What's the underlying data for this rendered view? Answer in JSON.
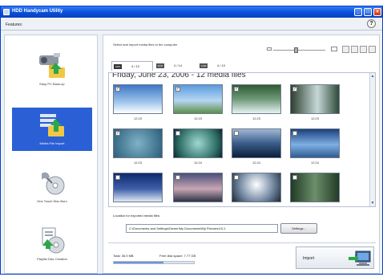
{
  "window": {
    "title": "HDD Handycam Utility",
    "help_label": "?"
  },
  "features_label": "Features:",
  "sidebar": {
    "items": [
      {
        "label": "Easy PC Back-up",
        "icon": "camera-to-folder-icon",
        "active": false
      },
      {
        "label": "Media File Import",
        "icon": "media-import-icon",
        "active": true
      },
      {
        "label": "One Touch Disc Burn",
        "icon": "disc-burn-icon",
        "active": false
      },
      {
        "label": "Playlist Disc Creation",
        "icon": "playlist-disc-icon",
        "active": false
      }
    ]
  },
  "main": {
    "instruction": "Select and import media files to the computer",
    "tabs": [
      {
        "badge": "HDD",
        "count": "4 / 10"
      },
      {
        "badge": "DVD",
        "count": "4 / 14"
      },
      {
        "badge": "CAM",
        "count": "4 / 10"
      }
    ],
    "date_heading": "Friday, June 23, 2006 - 12 media files",
    "thumbs": [
      {
        "time": "12:23",
        "checked": true
      },
      {
        "time": "12:23",
        "checked": true
      },
      {
        "time": "12:23",
        "checked": true
      },
      {
        "time": "12:23",
        "checked": true
      },
      {
        "time": "12:23",
        "checked": true
      },
      {
        "time": "12:24",
        "checked": false
      },
      {
        "time": "12:24",
        "checked": false
      },
      {
        "time": "12:24",
        "checked": false
      },
      {
        "time": "",
        "checked": false
      },
      {
        "time": "",
        "checked": false
      },
      {
        "time": "",
        "checked": false
      },
      {
        "time": "",
        "checked": false
      }
    ],
    "location_label": "Location for exported media files:",
    "location_path": "C:\\Documents and Settings\\Owner\\My Documents\\My Pictures\\10-1",
    "settings_label": "Settings...",
    "total_label": "Total: 36.9 MB",
    "free_label": "Free disk space: 7.77 GB",
    "usage_fraction": 0.62,
    "import_label": "Import"
  },
  "colors": {
    "accent": "#2a5fd6",
    "titlebar": "#0a4fd8"
  }
}
